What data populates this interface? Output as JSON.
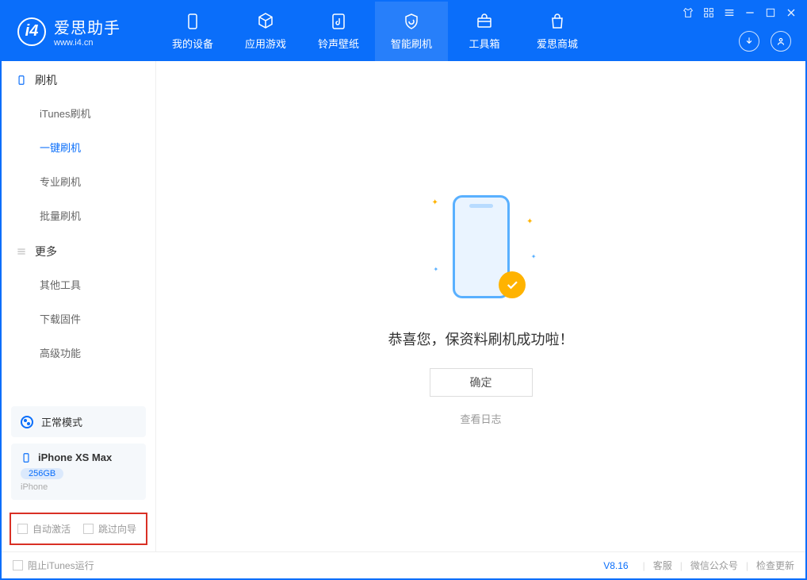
{
  "logo": {
    "title": "爱思助手",
    "url": "www.i4.cn"
  },
  "nav": [
    {
      "label": "我的设备"
    },
    {
      "label": "应用游戏"
    },
    {
      "label": "铃声壁纸"
    },
    {
      "label": "智能刷机"
    },
    {
      "label": "工具箱"
    },
    {
      "label": "爱思商城"
    }
  ],
  "sidebar": {
    "section1": {
      "title": "刷机",
      "items": [
        "iTunes刷机",
        "一键刷机",
        "专业刷机",
        "批量刷机"
      ]
    },
    "section2": {
      "title": "更多",
      "items": [
        "其他工具",
        "下载固件",
        "高级功能"
      ]
    }
  },
  "mode": {
    "label": "正常模式"
  },
  "device": {
    "name": "iPhone XS Max",
    "storage": "256GB",
    "type": "iPhone"
  },
  "checks": {
    "auto_activate": "自动激活",
    "skip_guide": "跳过向导"
  },
  "main": {
    "success_text": "恭喜您，保资料刷机成功啦！",
    "confirm": "确定",
    "view_log": "查看日志"
  },
  "footer": {
    "block_itunes": "阻止iTunes运行",
    "version": "V8.16",
    "links": [
      "客服",
      "微信公众号",
      "检查更新"
    ]
  }
}
